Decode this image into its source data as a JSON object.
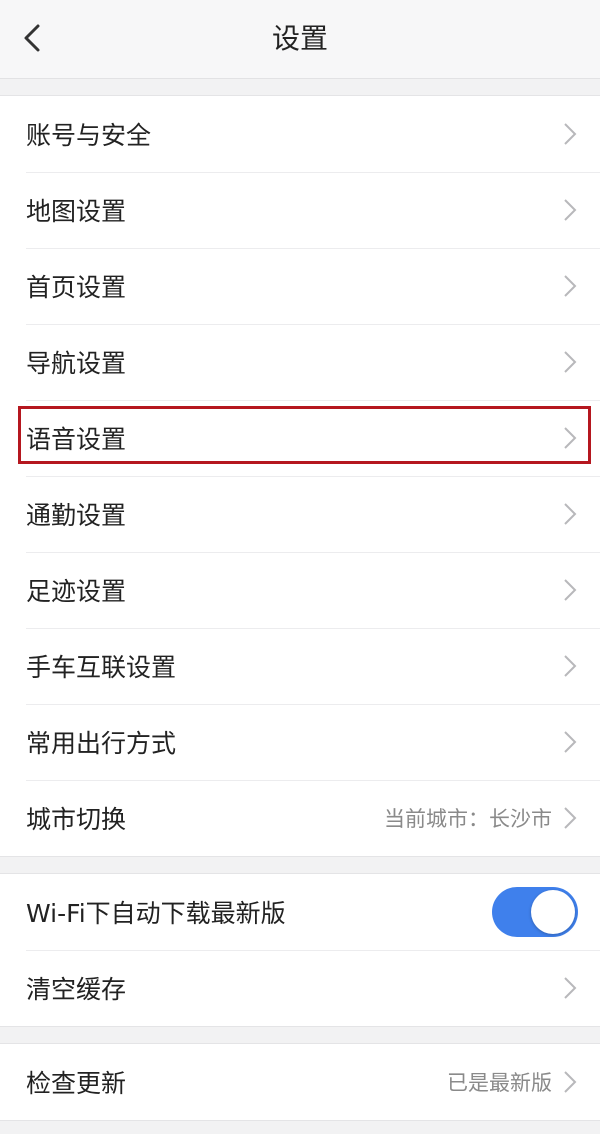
{
  "header": {
    "title": "设置"
  },
  "colors": {
    "accent": "#3f80ec",
    "highlight_border": "#b5171f"
  },
  "group1": {
    "items": [
      {
        "label": "账号与安全"
      },
      {
        "label": "地图设置"
      },
      {
        "label": "首页设置"
      },
      {
        "label": "导航设置"
      },
      {
        "label": "语音设置"
      },
      {
        "label": "通勤设置"
      },
      {
        "label": "足迹设置"
      },
      {
        "label": "手车互联设置"
      },
      {
        "label": "常用出行方式"
      },
      {
        "label": "城市切换",
        "value": "当前城市：长沙市"
      }
    ]
  },
  "group2": {
    "wifi_download": {
      "label": "Wi-Fi下自动下载最新版",
      "enabled": true
    },
    "clear_cache": {
      "label": "清空缓存"
    }
  },
  "group3": {
    "check_update": {
      "label": "检查更新",
      "value": "已是最新版"
    }
  }
}
